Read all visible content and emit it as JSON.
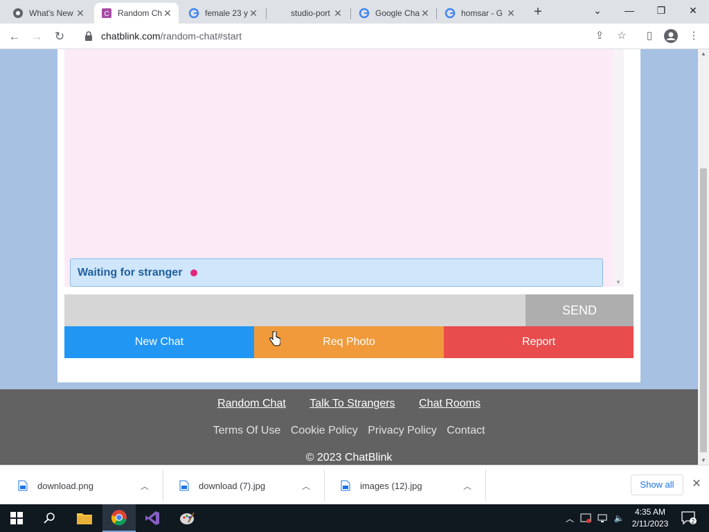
{
  "browser": {
    "tabs": [
      {
        "title": "What's New",
        "icon": "chrome-icon"
      },
      {
        "title": "Random Chat",
        "icon": "chatblink-icon"
      },
      {
        "title": "female 23 y",
        "icon": "google-icon"
      },
      {
        "title": "studio-port",
        "icon": "blank-icon"
      },
      {
        "title": "Google Chat",
        "icon": "google-icon"
      },
      {
        "title": "homsar - G",
        "icon": "google-icon"
      }
    ],
    "url_host": "chatblink.com",
    "url_path": "/random-chat#start"
  },
  "chat": {
    "status_text": "Waiting for stranger",
    "status_dot_color": "#e2267c",
    "message_placeholder": "",
    "send_label": "SEND",
    "new_chat_label": "New Chat",
    "req_photo_label": "Req Photo",
    "report_label": "Report"
  },
  "footer": {
    "links": [
      "Random Chat",
      "Talk To Strangers",
      "Chat Rooms"
    ],
    "policy_links": [
      "Terms Of Use",
      "Cookie Policy",
      "Privacy Policy",
      "Contact"
    ],
    "copyright": "© 2023 ChatBlink"
  },
  "downloads": {
    "items": [
      "download.png",
      "download (7).jpg",
      "images (12).jpg"
    ],
    "show_all_label": "Show all"
  },
  "taskbar": {
    "time": "4:35 AM",
    "date": "2/11/2023",
    "notification_count": "2"
  }
}
